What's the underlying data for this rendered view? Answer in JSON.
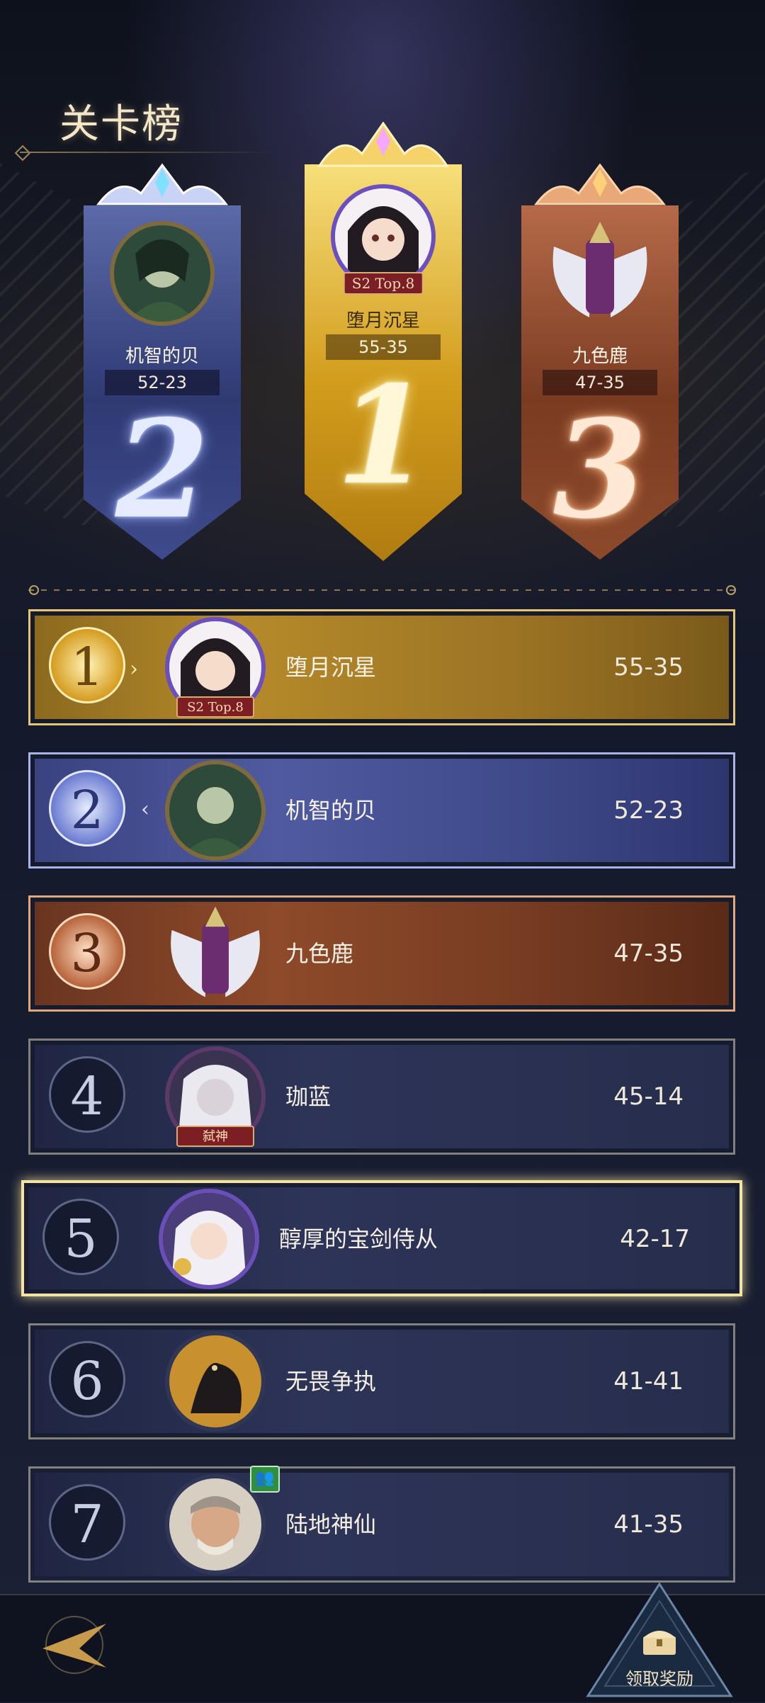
{
  "title": "关卡榜",
  "podium": [
    {
      "rank": "2",
      "name": "机智的贝",
      "score": "52-23",
      "tag": ""
    },
    {
      "rank": "1",
      "name": "堕月沉星",
      "score": "55-35",
      "tag": "S2 Top.8"
    },
    {
      "rank": "3",
      "name": "九色鹿",
      "score": "47-35",
      "tag": ""
    }
  ],
  "rows": [
    {
      "rank": "1",
      "name": "堕月沉星",
      "score": "55-35",
      "tag": "S2 Top.8"
    },
    {
      "rank": "2",
      "name": "机智的贝",
      "score": "52-23",
      "tag": ""
    },
    {
      "rank": "3",
      "name": "九色鹿",
      "score": "47-35",
      "tag": ""
    },
    {
      "rank": "4",
      "name": "珈蓝",
      "score": "45-14",
      "tag": "弑神"
    },
    {
      "rank": "5",
      "name": "醇厚的宝剑侍从",
      "score": "42-17",
      "tag": ""
    },
    {
      "rank": "6",
      "name": "无畏争执",
      "score": "41-41",
      "tag": ""
    },
    {
      "rank": "7",
      "name": "陆地神仙",
      "score": "41-35",
      "tag": ""
    }
  ],
  "highlighted_rank": "5",
  "footer": {
    "claim_label": "领取奖励",
    "back_icon": "back-arrow-icon",
    "claim_icon": "treasure-chest-icon"
  },
  "colors": {
    "gold": "#d29c1c",
    "silver": "#5b6aa8",
    "bronze": "#9c5632",
    "background": "#14192b"
  }
}
